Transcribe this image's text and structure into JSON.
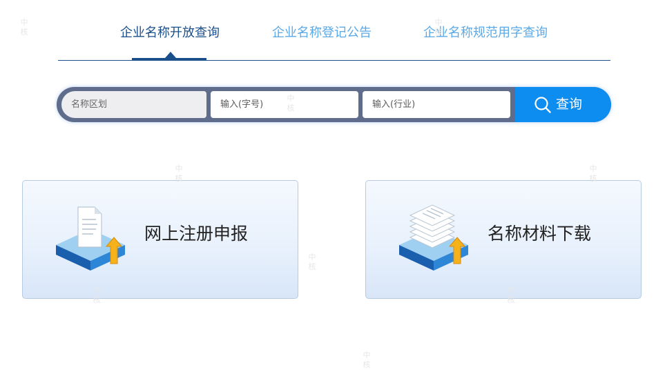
{
  "tabs": [
    {
      "label": "企业名称开放查询",
      "active": true
    },
    {
      "label": "企业名称登记公告",
      "active": false
    },
    {
      "label": "企业名称规范用字查询",
      "active": false
    }
  ],
  "search": {
    "region_placeholder": "名称区划",
    "name_placeholder": "输入(字号)",
    "industry_placeholder": "输入(行业)",
    "button_label": "查询",
    "button_icon": "search-icon"
  },
  "cards": [
    {
      "title": "网上注册申报",
      "icon": "document-upload-icon"
    },
    {
      "title": "名称材料下载",
      "icon": "stacked-documents-upload-icon"
    }
  ],
  "watermark": {
    "line1": "中",
    "line2": "核"
  },
  "colors": {
    "active_tab": "#1b4f8a",
    "inactive_tab": "#5aa9e6",
    "search_button": "#0e8df0",
    "search_bar_frame": "#5f6c8c"
  }
}
